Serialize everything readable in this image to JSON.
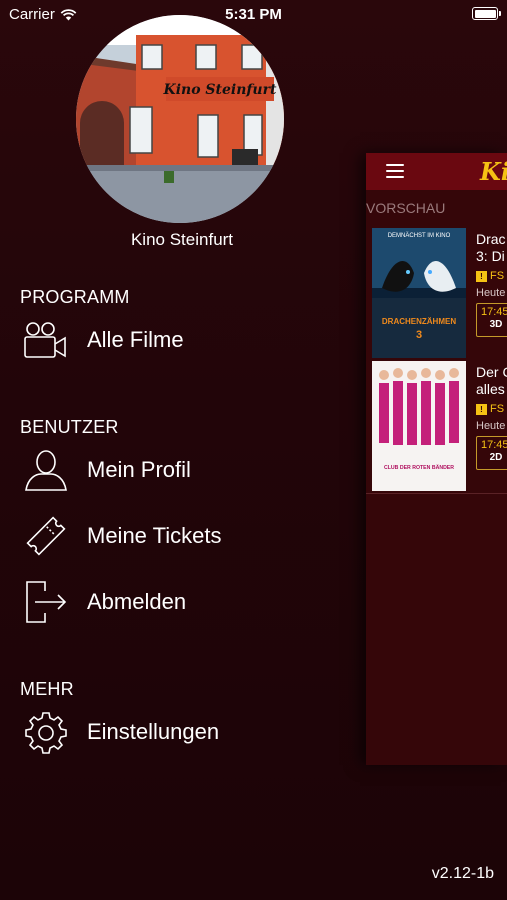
{
  "status_bar": {
    "carrier": "Carrier",
    "time": "5:31 PM"
  },
  "profile": {
    "theater_name": "Kino Steinfurt",
    "sign_text": "Kino Steinfurt"
  },
  "sections": [
    {
      "title": "PROGRAMM",
      "items": [
        {
          "label": "Alle Filme",
          "icon": "video-camera-icon"
        }
      ]
    },
    {
      "title": "BENUTZER",
      "items": [
        {
          "label": "Mein Profil",
          "icon": "user-icon"
        },
        {
          "label": "Meine Tickets",
          "icon": "ticket-icon"
        },
        {
          "label": "Abmelden",
          "icon": "logout-icon"
        }
      ]
    },
    {
      "title": "MEHR",
      "items": [
        {
          "label": "Einstellungen",
          "icon": "gear-icon"
        }
      ]
    }
  ],
  "version": "v2.12-1b",
  "content_preview": {
    "brand": "Kin",
    "section_label": "VORSCHAU",
    "movies": [
      {
        "title_line1": "Drac",
        "title_line2": "3: Di",
        "fsk": "FS",
        "day": "Heute",
        "time": "17:45",
        "format": "3D",
        "poster_tagline": "DEMNÄCHST IM KINO",
        "poster_title": "DRACHENZÄHMEN",
        "poster_number": "3"
      },
      {
        "title_line1": "Der C",
        "title_line2": "alles",
        "fsk": "FS",
        "day": "Heute",
        "time": "17:45",
        "format": "2D",
        "poster_title": "CLUB DER ROTEN BÄNDER"
      }
    ]
  },
  "colors": {
    "background": "#220509",
    "panel": "#350609",
    "header": "#6a0810",
    "accent": "#f5c214"
  }
}
